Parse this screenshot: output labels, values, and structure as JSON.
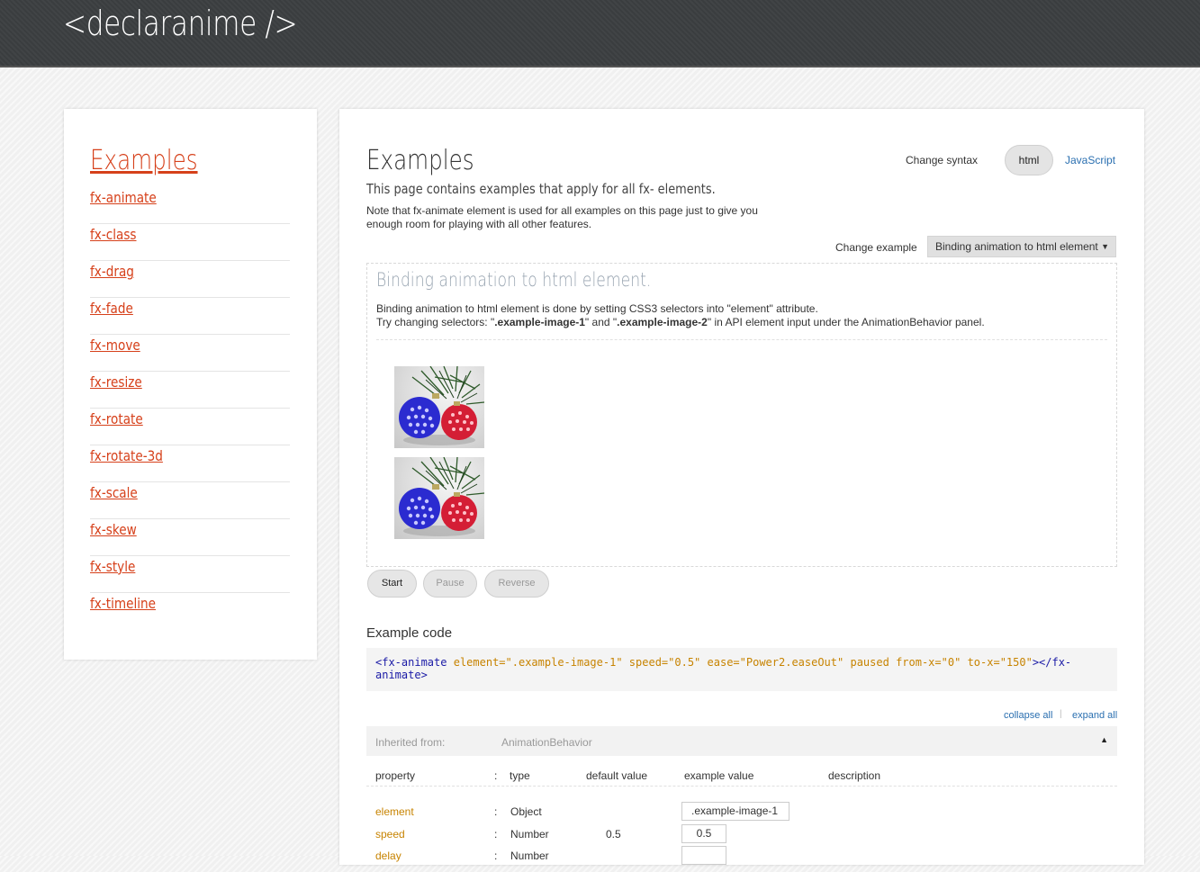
{
  "header": {
    "brand": "<declaranime />"
  },
  "sidebar": {
    "title": "Examples",
    "items": [
      {
        "label": "fx-animate"
      },
      {
        "label": "fx-class"
      },
      {
        "label": "fx-drag"
      },
      {
        "label": "fx-fade"
      },
      {
        "label": "fx-move"
      },
      {
        "label": "fx-resize"
      },
      {
        "label": "fx-rotate"
      },
      {
        "label": "fx-rotate-3d"
      },
      {
        "label": "fx-scale"
      },
      {
        "label": "fx-skew"
      },
      {
        "label": "fx-style"
      },
      {
        "label": "fx-timeline"
      }
    ]
  },
  "main": {
    "title": "Examples",
    "subtitle": "This page contains examples that apply for all fx- elements.",
    "note": "Note that fx-animate element is used for all examples on this page just to give you enough room for playing with all other features.",
    "syntax": {
      "label": "Change syntax",
      "html": "html",
      "javascript": "JavaScript",
      "selected": "html"
    },
    "example_select": {
      "label": "Change example",
      "value": "Binding animation to html element"
    },
    "demo": {
      "title": "Binding animation to html element.",
      "desc_line1": "Binding animation to html element is done by setting CSS3 selectors into \"element\" attribute.",
      "desc_line2_a": "Try changing selectors: \"",
      "desc_line2_b": ".example-image-1",
      "desc_line2_c": "\" and \"",
      "desc_line2_d": ".example-image-2",
      "desc_line2_e": "\" in API element input under the AnimationBehavior panel."
    },
    "controls": {
      "start": "Start",
      "pause": "Pause",
      "reverse": "Reverse"
    },
    "code": {
      "title": "Example code",
      "open_tag": "<fx-animate",
      "a1": "element=",
      "v1": "\".example-image-1\"",
      "a2": "speed=",
      "v2": "\"0.5\"",
      "a3": "ease=",
      "v3": "\"Power2.easeOut\"",
      "a4": "paused",
      "a5": "from-x=",
      "v5": "\"0\"",
      "a6": "to-x=",
      "v6": "\"150\"",
      "close_tag": "></fx-animate>"
    },
    "collapse_all": "collapse all",
    "separator": "|",
    "expand_all": "expand all",
    "inherited": {
      "label": "Inherited from:",
      "value": "AnimationBehavior",
      "toggle": "▲"
    },
    "table": {
      "headers": {
        "property": "property",
        "colon": ":",
        "type": "type",
        "default": "default value",
        "example": "example value",
        "description": "description"
      },
      "rows": [
        {
          "name": "element",
          "colon": ":",
          "type": "Object",
          "default": "",
          "example": ".example-image-1"
        },
        {
          "name": "speed",
          "colon": ":",
          "type": "Number",
          "default": "0.5",
          "example": "0.5"
        },
        {
          "name": "delay",
          "colon": ":",
          "type": "Number",
          "default": "",
          "example": ""
        }
      ]
    }
  }
}
